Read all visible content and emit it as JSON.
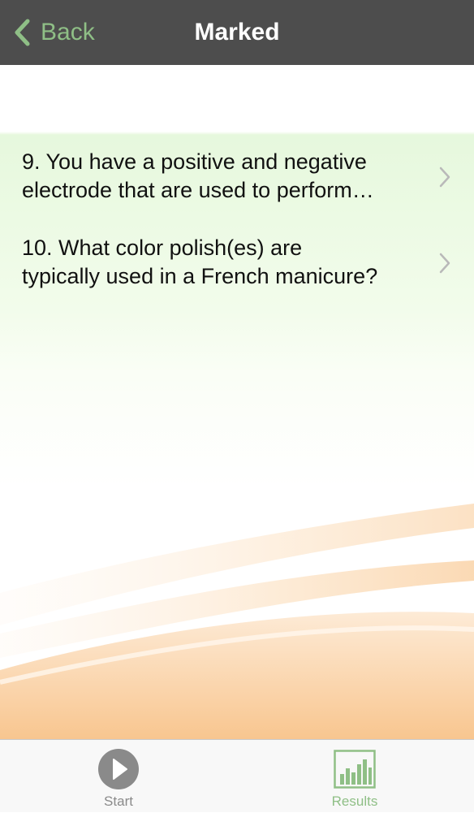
{
  "navbar": {
    "back_label": "Back",
    "back_icon": "chevron-left-icon",
    "title": "Marked",
    "background": "#4d4d4d",
    "accent": "#8fbf86"
  },
  "questions": [
    {
      "text": "9. You have a positive and negative\nelectrode that are used to perform…",
      "icon": "chevron-right-icon"
    },
    {
      "text": "10. What color polish(es) are\ntypically used in a French manicure?",
      "icon": "chevron-right-icon"
    }
  ],
  "tabbar": {
    "tabs": [
      {
        "label": "Start",
        "icon": "play-icon",
        "selected": false
      },
      {
        "label": "Results",
        "icon": "bar-chart-icon",
        "selected": true
      }
    ]
  },
  "theme": {
    "row_green": "#e6f8dd",
    "wave_orange": "#f6b46e"
  }
}
